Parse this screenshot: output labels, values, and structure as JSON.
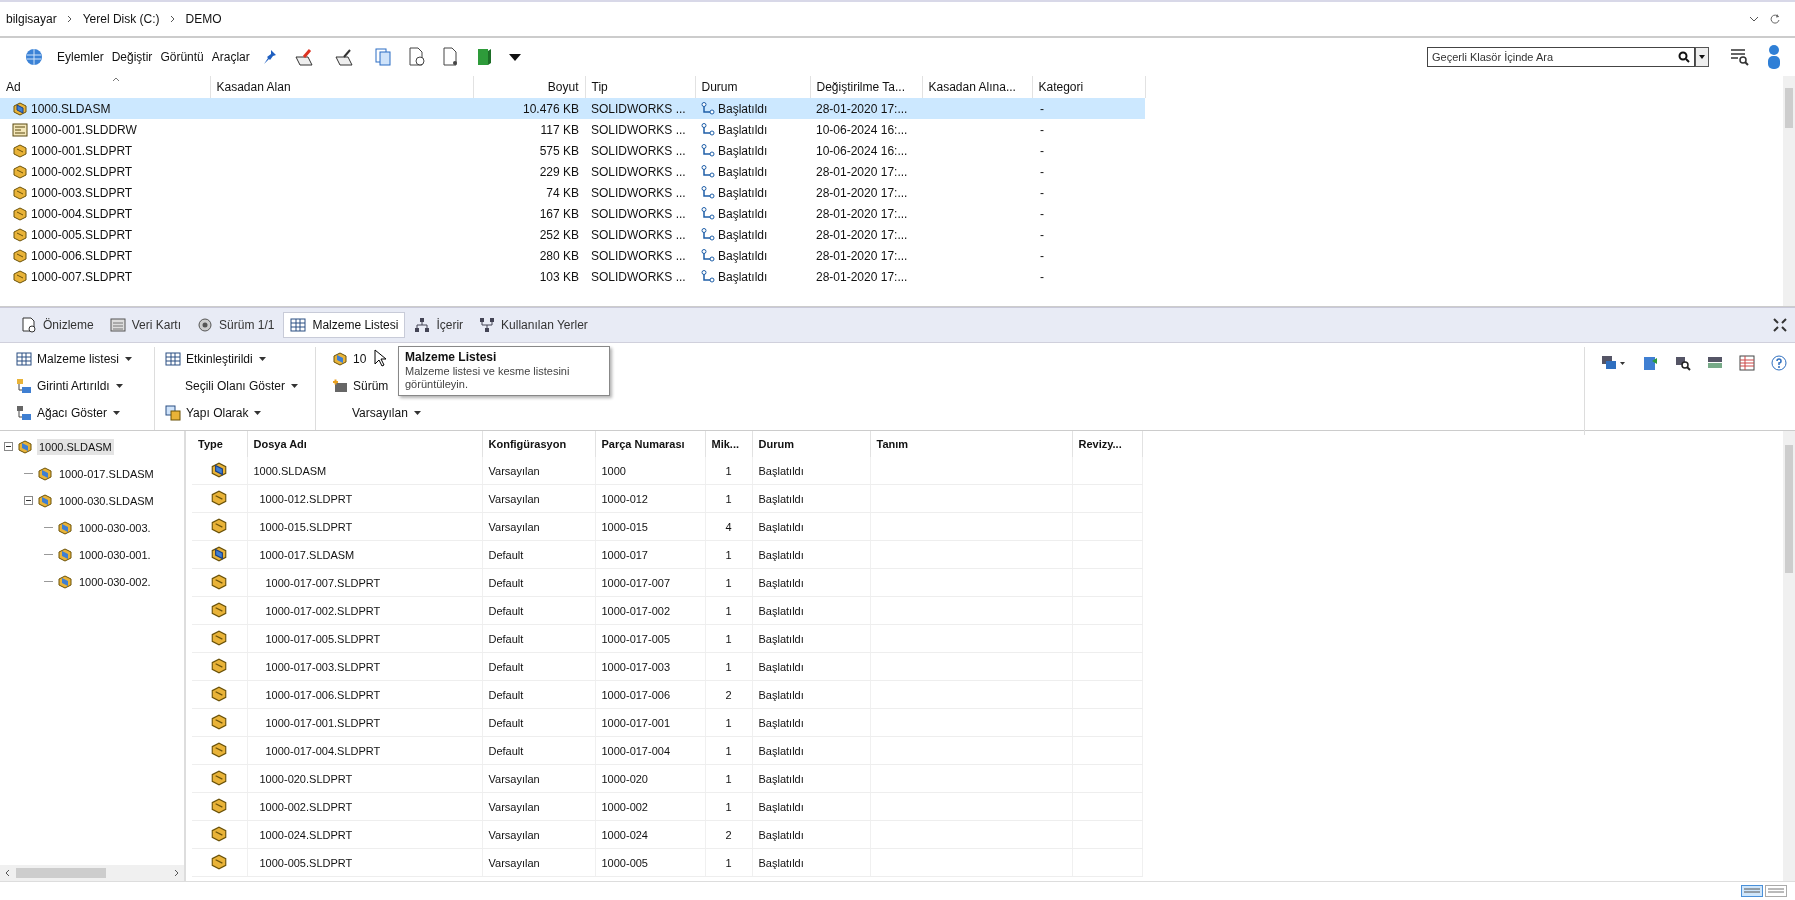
{
  "breadcrumb": [
    "bilgisayar",
    "Yerel Disk (C:)",
    "DEMO"
  ],
  "toolbar": {
    "menus": [
      "Eylemler",
      "Değiştir",
      "Görüntü",
      "Araçlar"
    ]
  },
  "search": {
    "placeholder": "Geçerli Klasör İçinde Ara"
  },
  "file_list": {
    "columns": [
      "Ad",
      "Kasadan Alan",
      "Boyut",
      "Tip",
      "Durum",
      "Değiştirilme Ta...",
      "Kasadan Alına...",
      "Kategori"
    ],
    "rows": [
      {
        "name": "1000.SLDASM",
        "kind": "assembly",
        "size": "10.476 KB",
        "type": "SOLIDWORKS ...",
        "status": "Başlatıldı",
        "modified": "28-01-2020 17:...",
        "category": "-",
        "selected": true
      },
      {
        "name": "1000-001.SLDDRW",
        "kind": "drawing",
        "size": "117 KB",
        "type": "SOLIDWORKS ...",
        "status": "Başlatıldı",
        "modified": "10-06-2024 16:...",
        "category": "-",
        "selected": false
      },
      {
        "name": "1000-001.SLDPRT",
        "kind": "part",
        "size": "575 KB",
        "type": "SOLIDWORKS ...",
        "status": "Başlatıldı",
        "modified": "10-06-2024 16:...",
        "category": "-",
        "selected": false
      },
      {
        "name": "1000-002.SLDPRT",
        "kind": "part",
        "size": "229 KB",
        "type": "SOLIDWORKS ...",
        "status": "Başlatıldı",
        "modified": "28-01-2020 17:...",
        "category": "-",
        "selected": false
      },
      {
        "name": "1000-003.SLDPRT",
        "kind": "part",
        "size": "74 KB",
        "type": "SOLIDWORKS ...",
        "status": "Başlatıldı",
        "modified": "28-01-2020 17:...",
        "category": "-",
        "selected": false
      },
      {
        "name": "1000-004.SLDPRT",
        "kind": "part",
        "size": "167 KB",
        "type": "SOLIDWORKS ...",
        "status": "Başlatıldı",
        "modified": "28-01-2020 17:...",
        "category": "-",
        "selected": false
      },
      {
        "name": "1000-005.SLDPRT",
        "kind": "part",
        "size": "252 KB",
        "type": "SOLIDWORKS ...",
        "status": "Başlatıldı",
        "modified": "28-01-2020 17:...",
        "category": "-",
        "selected": false
      },
      {
        "name": "1000-006.SLDPRT",
        "kind": "part",
        "size": "280 KB",
        "type": "SOLIDWORKS ...",
        "status": "Başlatıldı",
        "modified": "28-01-2020 17:...",
        "category": "-",
        "selected": false
      },
      {
        "name": "1000-007.SLDPRT",
        "kind": "part",
        "size": "103 KB",
        "type": "SOLIDWORKS ...",
        "status": "Başlatıldı",
        "modified": "28-01-2020 17:...",
        "category": "-",
        "selected": false
      }
    ]
  },
  "tabs": [
    {
      "label": "Önizleme",
      "kind": "preview",
      "selected": false
    },
    {
      "label": "Veri Kartı",
      "kind": "card",
      "selected": false
    },
    {
      "label": "Sürüm 1/1",
      "kind": "version",
      "selected": false
    },
    {
      "label": "Malzeme Listesi",
      "kind": "table",
      "selected": true
    },
    {
      "label": "İçerir",
      "kind": "contains",
      "selected": false
    },
    {
      "label": "Kullanılan Yerler",
      "kind": "whereused",
      "selected": false
    }
  ],
  "bom_toolbar": {
    "columns": [
      [
        {
          "label": "Malzeme listesi",
          "kind": "table"
        },
        {
          "label": "Girinti Artırıldı",
          "kind": "indent"
        },
        {
          "label": "Ağacı Göster",
          "kind": "tree"
        }
      ],
      [
        {
          "label": "Etkinleştirildi",
          "kind": "table"
        },
        {
          "label": "Seçili Olanı Göster",
          "kind": "none"
        },
        {
          "label": "Yapı Olarak",
          "kind": "structure"
        }
      ],
      [
        {
          "label": "10",
          "kind": "assembly"
        },
        {
          "label": "Sürüm",
          "kind": "version"
        },
        {
          "label": "Varsayılan",
          "kind": "none"
        }
      ]
    ]
  },
  "tooltip": {
    "title": "Malzeme Listesi",
    "text": "Malzeme listesi ve kesme listesini görüntüleyin."
  },
  "tree": [
    {
      "label": "1000.SLDASM",
      "selected": true,
      "expanded": true,
      "children": [
        {
          "label": "1000-017.SLDASM",
          "selected": false
        },
        {
          "label": "1000-030.SLDASM",
          "selected": false,
          "expanded": true,
          "children": [
            {
              "label": "1000-030-003.",
              "selected": false
            },
            {
              "label": "1000-030-001.",
              "selected": false
            },
            {
              "label": "1000-030-002.",
              "selected": false
            }
          ]
        }
      ]
    }
  ],
  "bom": {
    "columns": [
      "Type",
      "Dosya Adı",
      "Konfigürasyon",
      "Parça Numarası",
      "Mik...",
      "Durum",
      "Tanım",
      "Revizy..."
    ],
    "rows": [
      {
        "kind": "assembly",
        "name": "1000.SLDASM",
        "config": "Varsayılan",
        "part_number": "1000",
        "qty": "1",
        "status": "Başlatıldı",
        "children": [
          {
            "kind": "part",
            "name": "1000-012.SLDPRT",
            "config": "Varsayılan",
            "part_number": "1000-012",
            "qty": "1",
            "status": "Başlatıldı"
          },
          {
            "kind": "part",
            "name": "1000-015.SLDPRT",
            "config": "Varsayılan",
            "part_number": "1000-015",
            "qty": "4",
            "status": "Başlatıldı"
          },
          {
            "kind": "assembly",
            "name": "1000-017.SLDASM",
            "config": "Default",
            "part_number": "1000-017",
            "qty": "1",
            "status": "Başlatıldı",
            "children": [
              {
                "kind": "part",
                "name": "1000-017-007.SLDPRT",
                "config": "Default",
                "part_number": "1000-017-007",
                "qty": "1",
                "status": "Başlatıldı"
              },
              {
                "kind": "part",
                "name": "1000-017-002.SLDPRT",
                "config": "Default",
                "part_number": "1000-017-002",
                "qty": "1",
                "status": "Başlatıldı"
              },
              {
                "kind": "part",
                "name": "1000-017-005.SLDPRT",
                "config": "Default",
                "part_number": "1000-017-005",
                "qty": "1",
                "status": "Başlatıldı"
              },
              {
                "kind": "part",
                "name": "1000-017-003.SLDPRT",
                "config": "Default",
                "part_number": "1000-017-003",
                "qty": "1",
                "status": "Başlatıldı"
              },
              {
                "kind": "part",
                "name": "1000-017-006.SLDPRT",
                "config": "Default",
                "part_number": "1000-017-006",
                "qty": "2",
                "status": "Başlatıldı"
              },
              {
                "kind": "part",
                "name": "1000-017-001.SLDPRT",
                "config": "Default",
                "part_number": "1000-017-001",
                "qty": "1",
                "status": "Başlatıldı"
              },
              {
                "kind": "part",
                "name": "1000-017-004.SLDPRT",
                "config": "Default",
                "part_number": "1000-017-004",
                "qty": "1",
                "status": "Başlatıldı"
              }
            ]
          },
          {
            "kind": "part",
            "name": "1000-020.SLDPRT",
            "config": "Varsayılan",
            "part_number": "1000-020",
            "qty": "1",
            "status": "Başlatıldı"
          },
          {
            "kind": "part",
            "name": "1000-002.SLDPRT",
            "config": "Varsayılan",
            "part_number": "1000-002",
            "qty": "1",
            "status": "Başlatıldı"
          },
          {
            "kind": "part",
            "name": "1000-024.SLDPRT",
            "config": "Varsayılan",
            "part_number": "1000-024",
            "qty": "2",
            "status": "Başlatıldı"
          },
          {
            "kind": "part",
            "name": "1000-005.SLDPRT",
            "config": "Varsayılan",
            "part_number": "1000-005",
            "qty": "1",
            "status": "Başlatıldı"
          }
        ]
      }
    ]
  }
}
